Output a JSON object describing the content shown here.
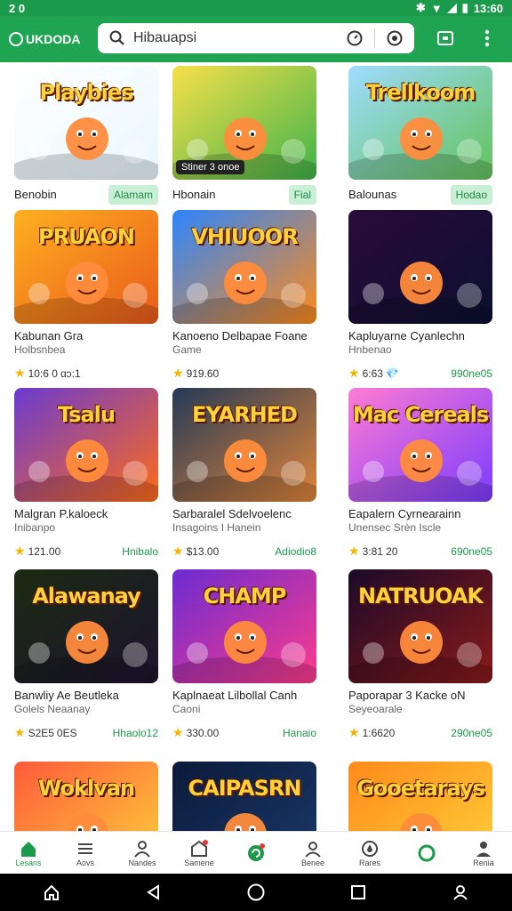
{
  "status": {
    "time_left": "2 0",
    "clock": "13:60"
  },
  "appbar": {
    "brand": "UKDODA",
    "search_value": "Hibauapsi"
  },
  "colors": {
    "primary": "#1fa551",
    "pill_bg": "#c9f0d6",
    "star": "#f4b400"
  },
  "grid": {
    "row1": [
      {
        "title": "Playbies",
        "name": "Benobin",
        "pill": "Alamam",
        "thumb": [
          "#ffffff",
          "#e8f7ff"
        ],
        "badge": ""
      },
      {
        "title": "",
        "name": "Hbonain",
        "pill": "Fial",
        "thumb": [
          "#f7e04a",
          "#3fb34a"
        ],
        "badge": "Stiner 3 onoe"
      },
      {
        "title": "Trellkoom",
        "name": "Balounas",
        "pill": "Hodao",
        "thumb": [
          "#9fdcff",
          "#62c25a"
        ],
        "badge": ""
      }
    ],
    "rows": [
      [
        {
          "title": "PRUAON",
          "name": "Kabunan Gra",
          "sub": "Holbsnbea",
          "rating": "10:6 0",
          "extra": "ɑɔ:1",
          "price": "",
          "thumb": [
            "#ffb020",
            "#e95a1a"
          ]
        },
        {
          "title": "VHIUOOR",
          "name": "Kanoeno Delbapae Foane",
          "sub": "Game",
          "rating": "919.60",
          "extra": "",
          "price": "",
          "thumb": [
            "#2b86ff",
            "#ff8a1a"
          ]
        },
        {
          "title": "",
          "name": "Kapluyarne Cyanlechn",
          "sub": "Hnbenao",
          "rating": "6:63",
          "extra": "💎",
          "price": "990ne05",
          "thumb": [
            "#2a0b3a",
            "#0b1030"
          ]
        }
      ],
      [
        {
          "title": "Tsalu",
          "name": "Malgran P.kaloeck",
          "sub": "Inibanpo",
          "rating": "121.00",
          "extra": "",
          "price": "Hnibalo",
          "thumb": [
            "#6a3bd1",
            "#ff6a1a"
          ]
        },
        {
          "title": "EYARHED",
          "name": "Sarbaralel Sdelvoelenc",
          "sub": "Insagoins I Hanein",
          "rating": "$13.00",
          "extra": "",
          "price": "Adiodio8",
          "thumb": [
            "#243a56",
            "#e0843a"
          ]
        },
        {
          "title": "Mac Cereals",
          "name": "Eapalern Cyrnearainn",
          "sub": "Unensec Srèn Iscle",
          "rating": "3:81 20",
          "extra": "",
          "price": "690ne05",
          "thumb": [
            "#ff7bd3",
            "#7b3cff"
          ]
        }
      ],
      [
        {
          "title": "Alawanay",
          "name": "Banwliy Ae Beutleka",
          "sub": "Golels Neaanay",
          "rating": "S2E5",
          "extra": "0ES",
          "price": "Hhaolo12",
          "thumb": [
            "#1a2a10",
            "#1e1430"
          ]
        },
        {
          "title": "CHAMP",
          "name": "Kaplnaeat Lilbollal Canh",
          "sub": "Caoni",
          "rating": "330.00",
          "extra": "",
          "price": "Hanaio",
          "thumb": [
            "#6a2bd1",
            "#ff3b8c"
          ]
        },
        {
          "title": "NATRUOAK",
          "name": "Paporapar 3 Kacke oN",
          "sub": "Seyeoarale",
          "rating": "1:6620",
          "extra": "",
          "price": "290ne05",
          "thumb": [
            "#1b0a28",
            "#8a1a1a"
          ]
        }
      ],
      [
        {
          "title": "Woklvan",
          "name": "",
          "sub": "",
          "rating": "",
          "extra": "",
          "price": "",
          "thumb": [
            "#ff5a3a",
            "#ffd23a"
          ]
        },
        {
          "title": "CAIPASRN",
          "name": "",
          "sub": "",
          "rating": "",
          "extra": "",
          "price": "",
          "thumb": [
            "#0b1a3a",
            "#1b3a6a"
          ]
        },
        {
          "title": "Gooetarays",
          "name": "",
          "sub": "",
          "rating": "",
          "extra": "",
          "price": "",
          "thumb": [
            "#ff8a1a",
            "#ffd23a"
          ]
        }
      ]
    ]
  },
  "bottom_nav": [
    {
      "label": "Lesans",
      "icon": "home-icon"
    },
    {
      "label": "Aovs",
      "icon": "list-icon"
    },
    {
      "label": "Nandes",
      "icon": "person-icon"
    },
    {
      "label": "Samene",
      "icon": "store-icon"
    },
    {
      "label": "",
      "icon": "refresh-icon"
    },
    {
      "label": "Benee",
      "icon": "user-icon"
    },
    {
      "label": "Rares",
      "icon": "drop-icon"
    },
    {
      "label": "",
      "icon": "cycle-icon"
    },
    {
      "label": "Renia",
      "icon": "account-icon"
    }
  ]
}
